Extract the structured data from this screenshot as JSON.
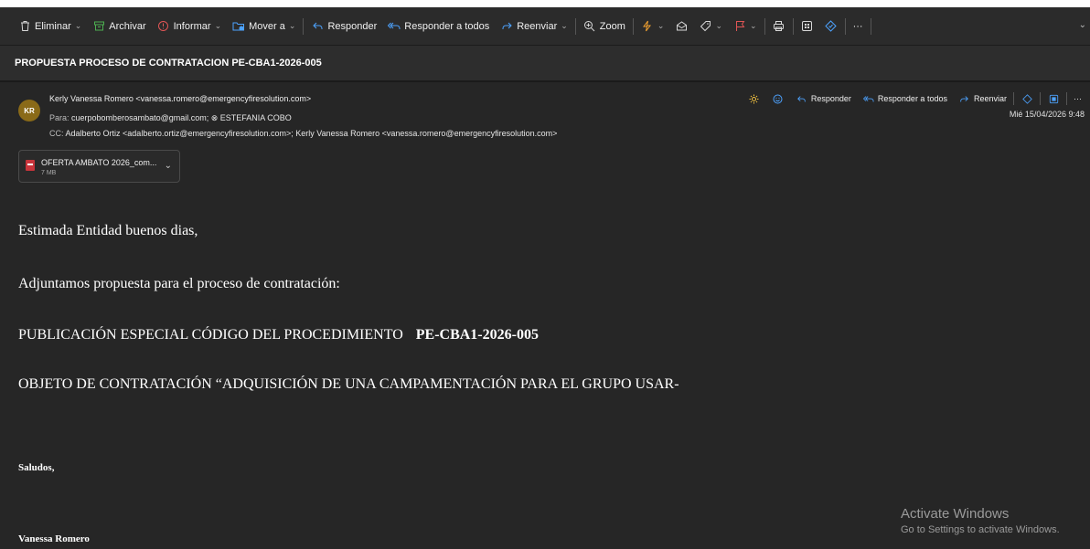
{
  "toolbar": {
    "delete_label": "Eliminar",
    "archive_label": "Archivar",
    "report_label": "Informar",
    "move_label": "Mover a",
    "reply_label": "Responder",
    "reply_all_label": "Responder a todos",
    "forward_label": "Reenviar",
    "zoom_label": "Zoom",
    "more_label": "···"
  },
  "subject": "PROPUESTA PROCESO DE CONTRATACION PE-CBA1-2026-005",
  "message": {
    "avatar_initials": "KR",
    "from": "Kerly Vanessa Romero <vanessa.romero@emergencyfiresolution.com>",
    "to_label": "Para:",
    "to": "cuerpobomberosambato@gmail.com;  ⊗ ESTEFANIA COBO",
    "cc_label": "CC:",
    "cc": "Adalberto Ortiz <adalberto.ortiz@emergencyfiresolution.com>;  Kerly Vanessa Romero <vanessa.romero@emergencyfiresolution.com>",
    "date": "Mié 15/04/2026 9:48",
    "actions": {
      "reply": "Responder",
      "reply_all": "Responder a todos",
      "forward": "Reenviar",
      "more": "···"
    }
  },
  "attachment": {
    "name": "OFERTA AMBATO 2026_com...",
    "size": "7 MB"
  },
  "body": {
    "greeting": "Estimada Entidad buenos dias,",
    "intro": "Adjuntamos propuesta para el proceso de contratación:",
    "publication_prefix": "PUBLICACIÓN ESPECIAL CÓDIGO DEL PROCEDIMIENTO",
    "publication_code": "PE-CBA1-2026-005",
    "object": "OBJETO DE CONTRATACIÓN “ADQUISICIÓN DE UNA CAMPAMENTACIÓN PARA EL GRUPO USAR-",
    "closing": "Saludos,",
    "signature": "Vanessa Romero"
  },
  "watermark": {
    "title": "Activate Windows",
    "subtitle": "Go to Settings to activate Windows."
  },
  "colors": {
    "accent_blue": "#4da3ff",
    "report_red": "#e05555",
    "archive_green": "#4caf50",
    "flag_red": "#e05555",
    "lightning_orange": "#f0a030",
    "avatar_bg": "#8a6a18"
  }
}
